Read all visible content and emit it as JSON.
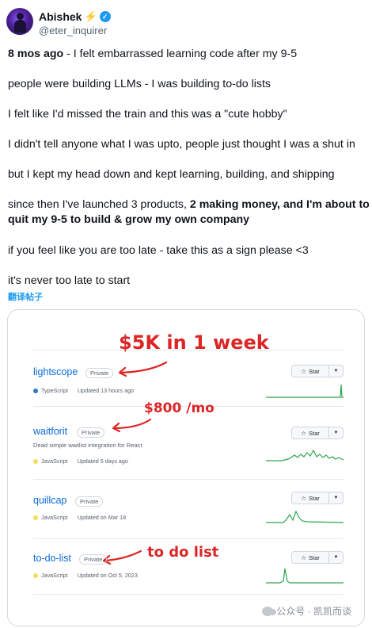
{
  "header": {
    "display_name": "Abishek",
    "name_emoji": "⚡",
    "handle": "@eter_inquirer",
    "verified_glyph": "✓",
    "more_glyph": "···"
  },
  "tweet": {
    "line1_time": "8 mos ago",
    "line1_text": " - I felt embarrassed learning code after my 9-5",
    "line2": "people were building LLMs - I was building to-do lists",
    "line3": "I felt like I'd missed the train and this was a \"cute hobby\"",
    "line4": "I didn't tell anyone what I was upto, people just thought I was a shut in",
    "line5": "but I kept my head down and kept learning, building, and shipping",
    "line6_plain": "since then I've launched 3 products, ",
    "line6_bold": "2 making money, and I'm about to",
    "line7_bold": "quit my 9-5 to build & grow my own company",
    "line8": "if you feel like you are too late - take this as a sign please <3",
    "line9": "it's never too late to start",
    "translate": "翻译帖子"
  },
  "repos": [
    {
      "name": "lightscope",
      "visibility": "Private",
      "description": "",
      "language": "TypeScript",
      "lang_color": "#3178c6",
      "updated": "Updated 13 hours ago",
      "star_label": "Star",
      "annotation": "$5K in 1 week"
    },
    {
      "name": "waitforit",
      "visibility": "Private",
      "description": "Dead simple waitlist integration for React",
      "language": "JavaScript",
      "lang_color": "#f1e05a",
      "updated": "Updated 5 days ago",
      "star_label": "Star",
      "annotation": "$800 /mo"
    },
    {
      "name": "quillcap",
      "visibility": "Private",
      "description": "",
      "language": "JavaScript",
      "lang_color": "#f1e05a",
      "updated": "Updated on Mar 18",
      "star_label": "Star",
      "annotation": ""
    },
    {
      "name": "to-do-list",
      "visibility": "Private",
      "description": "",
      "language": "JavaScript",
      "lang_color": "#f1e05a",
      "updated": "Updated on Oct 5, 2023",
      "star_label": "Star",
      "annotation": "to do list"
    }
  ],
  "colors": {
    "accent": "#1d9bf0",
    "link": "#0969da",
    "annotation": "#dc2626",
    "spark": "#2da44e"
  },
  "watermark": "公众号 · 凯凯而谈"
}
